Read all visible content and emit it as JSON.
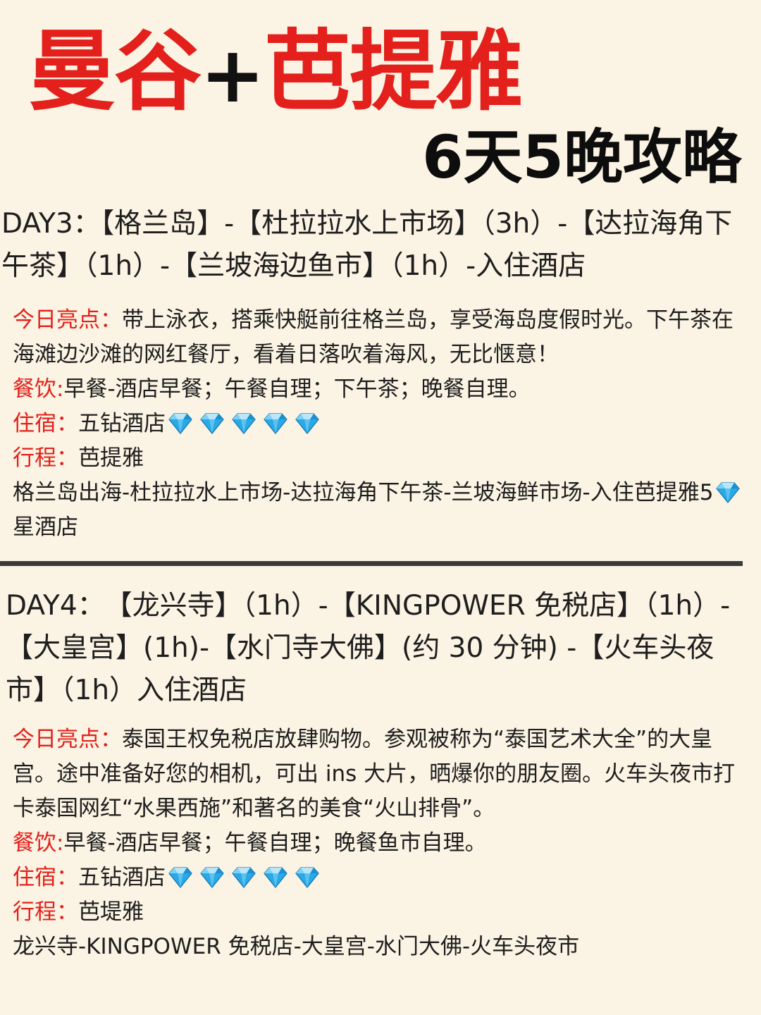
{
  "title": {
    "part1": "曼谷",
    "plus": "+",
    "part2": "芭提雅",
    "subtitle": "6天5晚攻略"
  },
  "colors": {
    "accent_red": "#e3201b",
    "background": "#fbf3e3",
    "text": "#1e1e1e",
    "gem_blue": "#29a9e6"
  },
  "day3": {
    "route": "DAY3：【格兰岛】-【杜拉拉水上市场】（3h）-【达拉海角下午茶】（1h）-【兰坡海边鱼市】（1h）-入住酒店",
    "highlight_label": "今日亮点：",
    "highlight_text": "带上泳衣，搭乘快艇前往格兰岛，享受海岛度假时光。下午茶在海滩边沙滩的网红餐厅，看着日落吹着海风，无比惬意！",
    "dining_label": "餐饮:",
    "dining_text": "早餐-酒店早餐；午餐自理；下午茶；晚餐自理。",
    "lodging_label": "住宿：",
    "lodging_text": "五钻酒店",
    "lodging_icon": "diamond-icon",
    "lodging_icon_count": 5,
    "itinerary_label": "行程：",
    "itinerary_place": "芭提雅",
    "itinerary_detail_before": "格兰岛出海-杜拉拉水上市场-达拉海角下午茶-兰坡海鲜市场-入住芭提雅5",
    "itinerary_detail_after": "星酒店"
  },
  "day4": {
    "route": "DAY4：　【龙兴寺】（1h）-【KINGPOWER 免税店】（1h）-【大皇宫】(1h)-【水门寺大佛】(约 30 分钟) -【火车头夜市】（1h）入住酒店",
    "highlight_label": "今日亮点：",
    "highlight_text": "泰国王权免税店放肆购物。参观被称为“泰国艺术大全”的大皇宫。途中准备好您的相机，可出 ins 大片，晒爆你的朋友圈。火车头夜市打卡泰国网红“水果西施”和著名的美食“火山排骨”。",
    "dining_label": "餐饮:",
    "dining_text": "早餐-酒店早餐；午餐自理；晚餐鱼市自理。",
    "lodging_label": "住宿：",
    "lodging_text": "五钻酒店",
    "lodging_icon": "diamond-icon",
    "lodging_icon_count": 5,
    "itinerary_label": "行程：",
    "itinerary_place": "芭堤雅",
    "itinerary_detail": "龙兴寺-KINGPOWER 免税店-大皇宫-水门大佛-火车头夜市"
  }
}
